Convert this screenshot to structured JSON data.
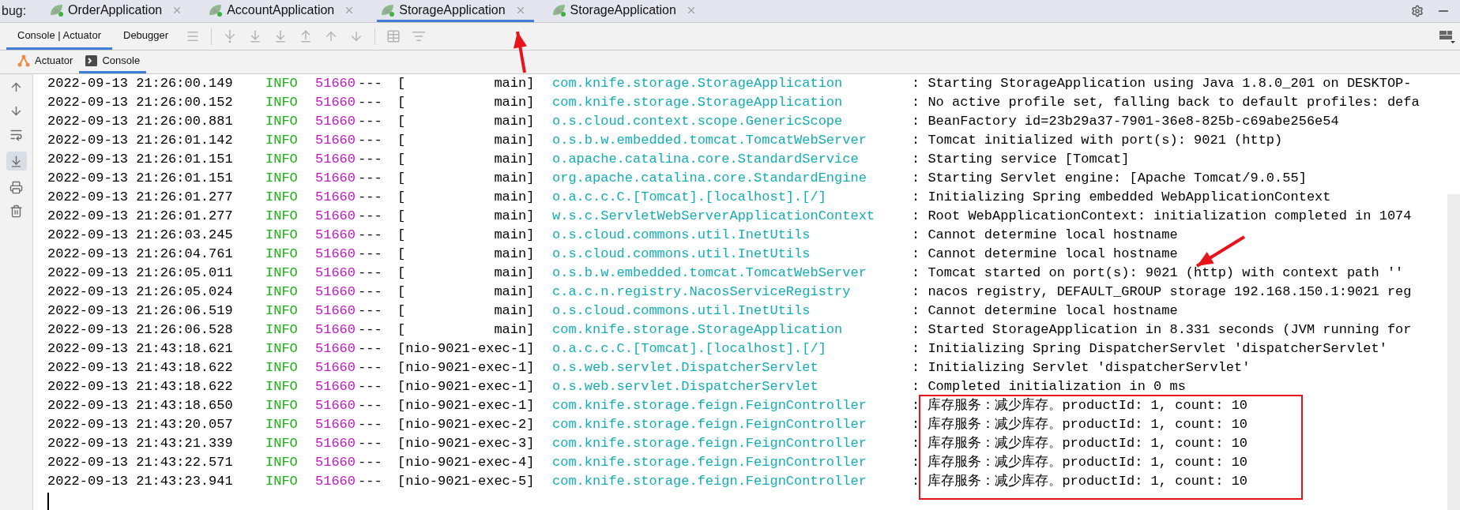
{
  "debug_label": "bug:",
  "run_tabs": [
    {
      "label": "OrderApplication",
      "selected": false
    },
    {
      "label": "AccountApplication",
      "selected": false
    },
    {
      "label": "StorageApplication",
      "selected": true
    },
    {
      "label": "StorageApplication",
      "selected": false
    }
  ],
  "toolbar_tabs": [
    {
      "label": "Console | Actuator",
      "selected": true
    },
    {
      "label": "Debugger",
      "selected": false
    }
  ],
  "sub_tabs": [
    {
      "label": "Actuator",
      "kind": "actuator",
      "selected": false
    },
    {
      "label": "Console",
      "kind": "console",
      "selected": true
    }
  ],
  "log_rows": [
    {
      "time": "2022-09-13 21:26:00.149",
      "level": "INFO",
      "pid": "51660",
      "sep": "---",
      "thread": "[           main]",
      "logger": "com.knife.storage.StorageApplication",
      "message": ": Starting StorageApplication using Java 1.8.0_201 on DESKTOP-"
    },
    {
      "time": "2022-09-13 21:26:00.152",
      "level": "INFO",
      "pid": "51660",
      "sep": "---",
      "thread": "[           main]",
      "logger": "com.knife.storage.StorageApplication",
      "message": ": No active profile set, falling back to default profiles: defa"
    },
    {
      "time": "2022-09-13 21:26:00.881",
      "level": "INFO",
      "pid": "51660",
      "sep": "---",
      "thread": "[           main]",
      "logger": "o.s.cloud.context.scope.GenericScope",
      "message": ": BeanFactory id=23b29a37-7901-36e8-825b-c69abe256e54"
    },
    {
      "time": "2022-09-13 21:26:01.142",
      "level": "INFO",
      "pid": "51660",
      "sep": "---",
      "thread": "[           main]",
      "logger": "o.s.b.w.embedded.tomcat.TomcatWebServer",
      "message": ": Tomcat initialized with port(s): 9021 (http)"
    },
    {
      "time": "2022-09-13 21:26:01.151",
      "level": "INFO",
      "pid": "51660",
      "sep": "---",
      "thread": "[           main]",
      "logger": "o.apache.catalina.core.StandardService",
      "message": ": Starting service [Tomcat]"
    },
    {
      "time": "2022-09-13 21:26:01.151",
      "level": "INFO",
      "pid": "51660",
      "sep": "---",
      "thread": "[           main]",
      "logger": "org.apache.catalina.core.StandardEngine",
      "message": ": Starting Servlet engine: [Apache Tomcat/9.0.55]"
    },
    {
      "time": "2022-09-13 21:26:01.277",
      "level": "INFO",
      "pid": "51660",
      "sep": "---",
      "thread": "[           main]",
      "logger": "o.a.c.c.C.[Tomcat].[localhost].[/]",
      "message": ": Initializing Spring embedded WebApplicationContext"
    },
    {
      "time": "2022-09-13 21:26:01.277",
      "level": "INFO",
      "pid": "51660",
      "sep": "---",
      "thread": "[           main]",
      "logger": "w.s.c.ServletWebServerApplicationContext",
      "message": ": Root WebApplicationContext: initialization completed in 1074"
    },
    {
      "time": "2022-09-13 21:26:03.245",
      "level": "INFO",
      "pid": "51660",
      "sep": "---",
      "thread": "[           main]",
      "logger": "o.s.cloud.commons.util.InetUtils",
      "message": ": Cannot determine local hostname"
    },
    {
      "time": "2022-09-13 21:26:04.761",
      "level": "INFO",
      "pid": "51660",
      "sep": "---",
      "thread": "[           main]",
      "logger": "o.s.cloud.commons.util.InetUtils",
      "message": ": Cannot determine local hostname"
    },
    {
      "time": "2022-09-13 21:26:05.011",
      "level": "INFO",
      "pid": "51660",
      "sep": "---",
      "thread": "[           main]",
      "logger": "o.s.b.w.embedded.tomcat.TomcatWebServer",
      "message": ": Tomcat started on port(s): 9021 (http) with context path ''"
    },
    {
      "time": "2022-09-13 21:26:05.024",
      "level": "INFO",
      "pid": "51660",
      "sep": "---",
      "thread": "[           main]",
      "logger": "c.a.c.n.registry.NacosServiceRegistry",
      "message": ": nacos registry, DEFAULT_GROUP storage 192.168.150.1:9021 reg"
    },
    {
      "time": "2022-09-13 21:26:06.519",
      "level": "INFO",
      "pid": "51660",
      "sep": "---",
      "thread": "[           main]",
      "logger": "o.s.cloud.commons.util.InetUtils",
      "message": ": Cannot determine local hostname"
    },
    {
      "time": "2022-09-13 21:26:06.528",
      "level": "INFO",
      "pid": "51660",
      "sep": "---",
      "thread": "[           main]",
      "logger": "com.knife.storage.StorageApplication",
      "message": ": Started StorageApplication in 8.331 seconds (JVM running for"
    },
    {
      "time": "2022-09-13 21:43:18.621",
      "level": "INFO",
      "pid": "51660",
      "sep": "---",
      "thread": "[nio-9021-exec-1]",
      "logger": "o.a.c.c.C.[Tomcat].[localhost].[/]",
      "message": ": Initializing Spring DispatcherServlet 'dispatcherServlet'"
    },
    {
      "time": "2022-09-13 21:43:18.622",
      "level": "INFO",
      "pid": "51660",
      "sep": "---",
      "thread": "[nio-9021-exec-1]",
      "logger": "o.s.web.servlet.DispatcherServlet",
      "message": ": Initializing Servlet 'dispatcherServlet'"
    },
    {
      "time": "2022-09-13 21:43:18.622",
      "level": "INFO",
      "pid": "51660",
      "sep": "---",
      "thread": "[nio-9021-exec-1]",
      "logger": "o.s.web.servlet.DispatcherServlet",
      "message": ": Completed initialization in 0 ms"
    },
    {
      "time": "2022-09-13 21:43:18.650",
      "level": "INFO",
      "pid": "51660",
      "sep": "---",
      "thread": "[nio-9021-exec-1]",
      "logger": "com.knife.storage.feign.FeignController",
      "message": ": 库存服务：减少库存。productId: 1, count: 10"
    },
    {
      "time": "2022-09-13 21:43:20.057",
      "level": "INFO",
      "pid": "51660",
      "sep": "---",
      "thread": "[nio-9021-exec-2]",
      "logger": "com.knife.storage.feign.FeignController",
      "message": ": 库存服务：减少库存。productId: 1, count: 10"
    },
    {
      "time": "2022-09-13 21:43:21.339",
      "level": "INFO",
      "pid": "51660",
      "sep": "---",
      "thread": "[nio-9021-exec-3]",
      "logger": "com.knife.storage.feign.FeignController",
      "message": ": 库存服务：减少库存。productId: 1, count: 10"
    },
    {
      "time": "2022-09-13 21:43:22.571",
      "level": "INFO",
      "pid": "51660",
      "sep": "---",
      "thread": "[nio-9021-exec-4]",
      "logger": "com.knife.storage.feign.FeignController",
      "message": ": 库存服务：减少库存。productId: 1, count: 10"
    },
    {
      "time": "2022-09-13 21:43:23.941",
      "level": "INFO",
      "pid": "51660",
      "sep": "---",
      "thread": "[nio-9021-exec-5]",
      "logger": "com.knife.storage.feign.FeignController",
      "message": ": 库存服务：减少库存。productId: 1, count: 10"
    }
  ],
  "annotations": [
    {
      "kind": "arrow"
    },
    {
      "kind": "arrow"
    },
    {
      "kind": "box"
    }
  ]
}
